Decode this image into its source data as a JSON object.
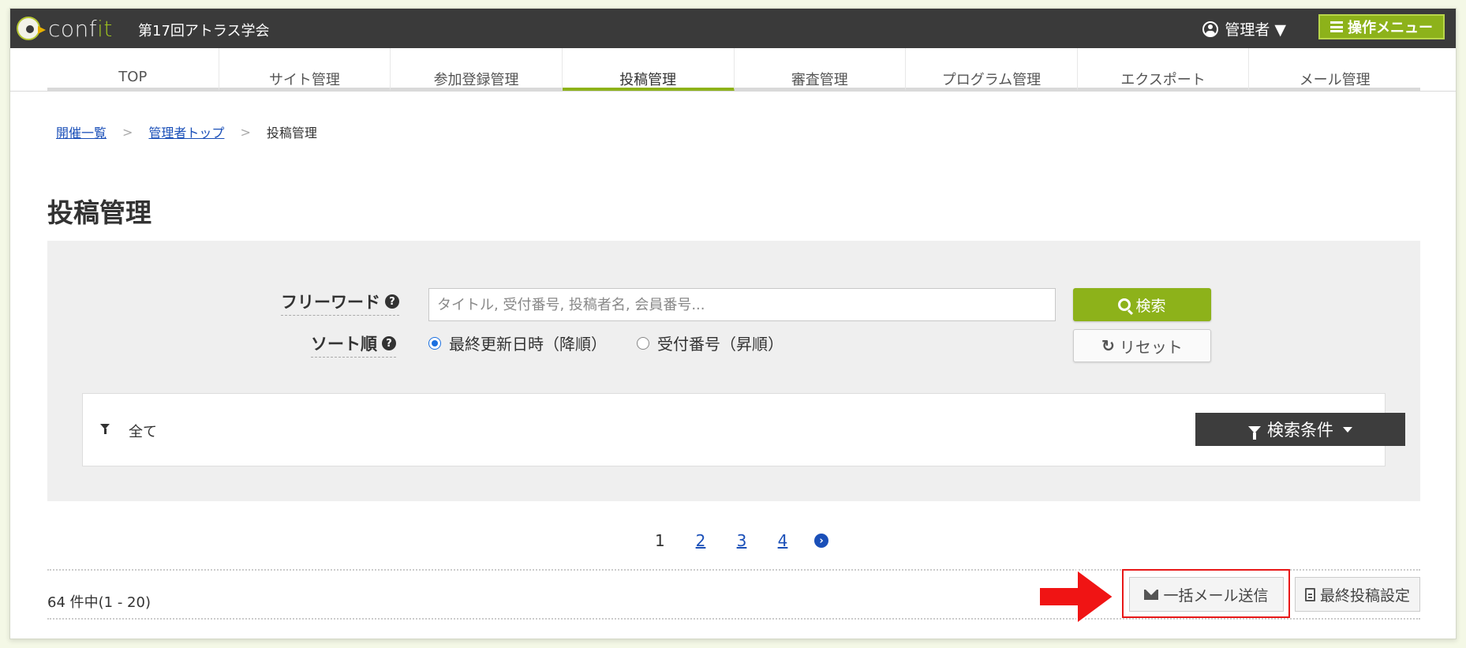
{
  "header": {
    "logo_text": "conf",
    "logo_text_accent": "it",
    "conference_title": "第17回アトラス学会",
    "admin_label": "管理者 ▼",
    "operations_menu_label": "操作メニュー"
  },
  "tabs": [
    {
      "label": "TOP",
      "active": false
    },
    {
      "label": "サイト管理",
      "active": false
    },
    {
      "label": "参加登録管理",
      "active": false
    },
    {
      "label": "投稿管理",
      "active": true
    },
    {
      "label": "審査管理",
      "active": false
    },
    {
      "label": "プログラム管理",
      "active": false
    },
    {
      "label": "エクスポート",
      "active": false
    },
    {
      "label": "メール管理",
      "active": false
    }
  ],
  "breadcrumb": {
    "items": [
      "開催一覧",
      "管理者トップ"
    ],
    "separator": ">",
    "current": "投稿管理"
  },
  "page_title": "投稿管理",
  "search": {
    "free_word_label": "フリーワード",
    "free_word_placeholder": "タイトル, 受付番号, 投稿者名, 会員番号...",
    "free_word_value": "",
    "sort_label": "ソート順",
    "sort_options": [
      {
        "label": "最終更新日時（降順）",
        "checked": true
      },
      {
        "label": "受付番号（昇順）",
        "checked": false
      }
    ],
    "search_button": "検索",
    "reset_button": "リセット",
    "filter_status": "全て",
    "conditions_button": "検索条件"
  },
  "pagination": {
    "current": "1",
    "pages": [
      "2",
      "3",
      "4"
    ]
  },
  "results": {
    "count_text": "64 件中(1 - 20)"
  },
  "actions": {
    "bulk_mail_button": "一括メール送信",
    "final_submission_button": "最終投稿設定"
  },
  "colors": {
    "accent_green": "#8db21a",
    "topbar": "#3a3a3a",
    "highlight_red": "#e81818",
    "link_blue": "#1a4fb8"
  }
}
